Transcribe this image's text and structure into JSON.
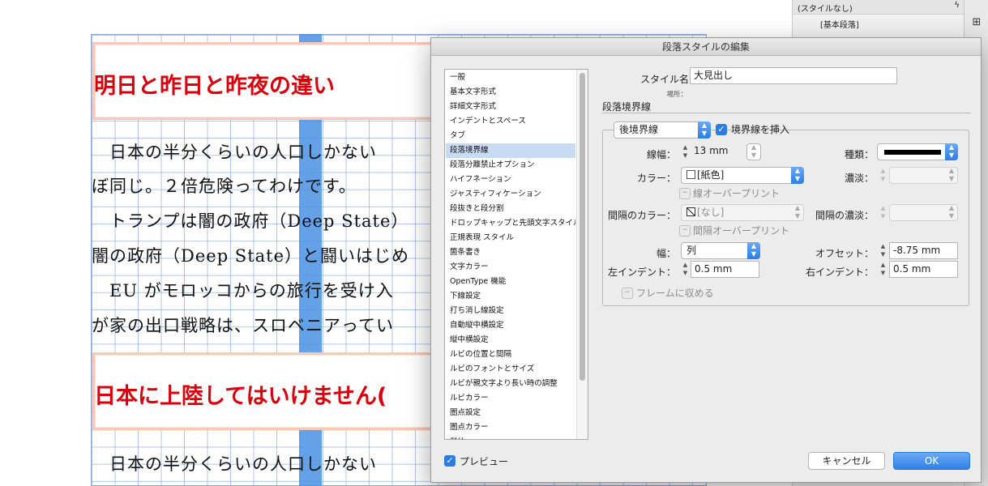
{
  "document": {
    "heading1": "明日と昨日と昨夜の違い",
    "heading2": "日本に上陸してはいけません(",
    "lines": [
      "　日本の半分くらいの人口しかない",
      "ぼ同じ。２倍危険ってわけです。",
      "　トランプは闇の政府（Deep State）",
      "闇の政府（Deep State）と闘いはじめ",
      "　EU がモロッコからの旅行を受け入",
      "が家の出口戦略は、スロベニアってい",
      "　日本の半分くらいの人口しかない"
    ]
  },
  "panel": {
    "row1": "(スタイルなし)",
    "row2": "[基本段落]"
  },
  "dialog": {
    "title": "段落スタイルの編集",
    "categories": [
      "一般",
      "基本文字形式",
      "詳細文字形式",
      "インデントとスペース",
      "タブ",
      "段落境界線",
      "段落分離禁止オプション",
      "ハイフネーション",
      "ジャスティフィケーション",
      "段抜きと段分割",
      "ドロップキャップと先頭文字スタイル",
      "正規表現 スタイル",
      "箇条書き",
      "文字カラー",
      "OpenType 機能",
      "下線設定",
      "打ち消し線設定",
      "自動縦中横設定",
      "縦中横設定",
      "ルビの位置と間隔",
      "ルビのフォントとサイズ",
      "ルビが親文字より長い時の調整",
      "ルビカラー",
      "圏点設定",
      "圏点カラー",
      "斜体"
    ],
    "selected_category": "段落境界線",
    "style_name_label": "スタイル名：",
    "style_name_value": "大見出し",
    "location_label": "場所：",
    "section_title": "段落境界線",
    "rule_type": "後境界線",
    "rule_on_label": "境界線を挿入",
    "rule_on_checked": true,
    "weight_label": "線幅：",
    "weight_value": "13 mm",
    "type_label": "種類：",
    "color_label": "カラー：",
    "color_value": "[紙色]",
    "tint_label": "濃淡：",
    "tint_value": "",
    "overprint_label": "線オーバープリント",
    "gap_color_label": "間隔のカラー：",
    "gap_color_value": "[なし]",
    "gap_tint_label": "間隔の濃淡：",
    "gap_tint_value": "",
    "gap_overprint_label": "間隔オーバープリント",
    "width_label": "幅：",
    "width_value": "列",
    "offset_label": "オフセット：",
    "offset_value": "-8.75 mm",
    "left_indent_label": "左インデント：",
    "left_indent_value": "0.5 mm",
    "right_indent_label": "右インデント：",
    "right_indent_value": "0.5 mm",
    "keep_in_frame_label": "フレームに収める",
    "preview_label": "プレビュー",
    "preview_checked": true,
    "cancel_label": "キャンセル",
    "ok_label": "OK"
  },
  "colors": {
    "accent": "#2d7be5",
    "heading_red": "#d9000c",
    "column_highlight": "#4a90e2"
  }
}
